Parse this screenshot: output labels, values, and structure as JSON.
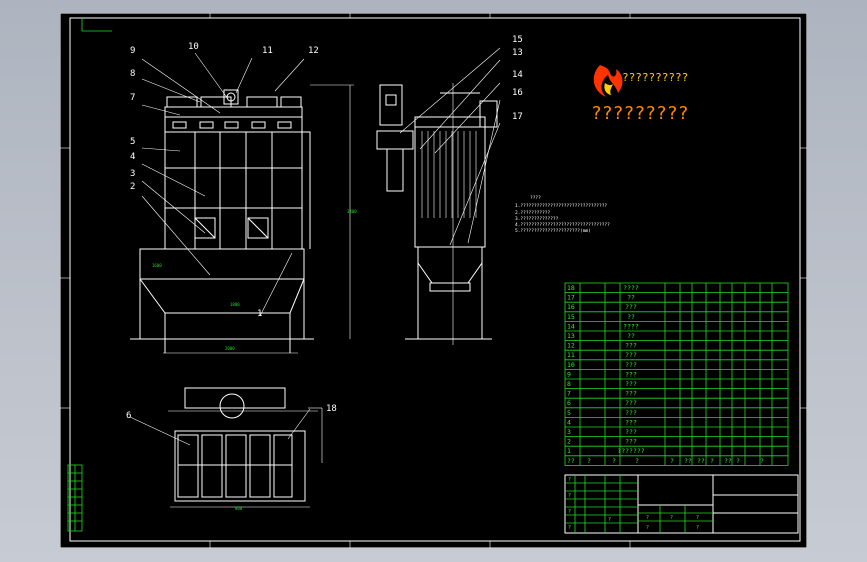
{
  "callouts": [
    "1",
    "2",
    "3",
    "4",
    "5",
    "6",
    "7",
    "8",
    "9",
    "10",
    "11",
    "12",
    "13",
    "14",
    "15",
    "16",
    "17",
    "18"
  ],
  "brand": {
    "top": "??????????",
    "main": "?????????",
    "colors": {
      "flame_outer": "#ff3300",
      "flame_inner": "#ffcc00",
      "text": "#ff8800"
    }
  },
  "notes": {
    "title": "????",
    "lines": [
      "1.????????????????????????????????",
      "2.???????????",
      "3.??????????????",
      "4.?????????????????????????????????",
      "5.??????????????????????(mm)"
    ]
  },
  "bom": {
    "rows": [
      {
        "no": "18",
        "name": "????"
      },
      {
        "no": "17",
        "name": "??"
      },
      {
        "no": "16",
        "name": "???"
      },
      {
        "no": "15",
        "name": "??"
      },
      {
        "no": "14",
        "name": "????"
      },
      {
        "no": "13",
        "name": "??"
      },
      {
        "no": "12",
        "name": "???"
      },
      {
        "no": "11",
        "name": "???"
      },
      {
        "no": "10",
        "name": "???"
      },
      {
        "no": "9",
        "name": "???"
      },
      {
        "no": "8",
        "name": "???"
      },
      {
        "no": "7",
        "name": "???"
      },
      {
        "no": "6",
        "name": "???"
      },
      {
        "no": "5",
        "name": "???"
      },
      {
        "no": "4",
        "name": "???"
      },
      {
        "no": "3",
        "name": "???"
      },
      {
        "no": "2",
        "name": "???"
      },
      {
        "no": "1",
        "name": "???????"
      }
    ],
    "header": [
      "??",
      "?",
      "?",
      "?",
      "?",
      "??",
      "??",
      "?",
      "??",
      "?",
      "?"
    ]
  },
  "titleblock": {
    "cells": [
      "?",
      "?",
      "?",
      "?",
      "?",
      "?",
      "?",
      "?",
      "?",
      "?"
    ]
  },
  "dims": [
    "2000",
    "1800",
    "2500",
    "3400",
    "1600",
    "800"
  ],
  "colors": {
    "background": "#000000",
    "lines": "#ffffff",
    "table": "#22dd22",
    "frame_bg": "#b9bec8"
  }
}
